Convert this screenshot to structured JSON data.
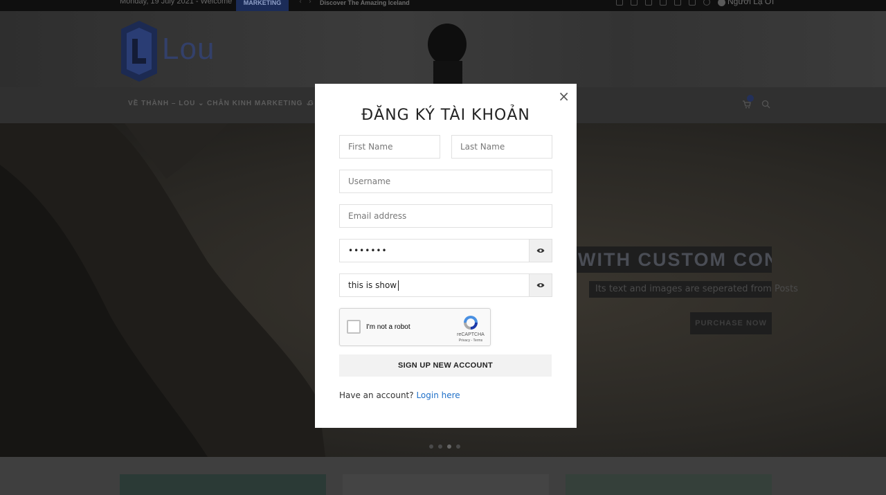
{
  "topbar": {
    "date": "Monday, 19 July 2021 - Welcome",
    "tag": "MARKETING",
    "news": "Discover The Amazing Iceland",
    "user": "Người Lạ Ơi"
  },
  "header": {
    "logo_text": "Lou"
  },
  "nav": {
    "items": [
      "VỀ THÀNH – LOU",
      "CHÂN KINH MARKETING",
      "G"
    ]
  },
  "hero": {
    "headline": "K WITH CUSTOM CONTENT",
    "subtext": "Its text and images are seperated from Posts",
    "button": "PURCHASE NOW"
  },
  "modal": {
    "title": "ĐĂNG KÝ TÀI KHOẢN",
    "close": "×",
    "first_name_placeholder": "First Name",
    "last_name_placeholder": "Last Name",
    "username_placeholder": "Username",
    "email_placeholder": "Email address",
    "password_value": "•••••••",
    "confirm_value": "this is show",
    "captcha": {
      "label": "I'm not a robot",
      "brand": "reCAPTCHA",
      "links": "Privacy - Terms"
    },
    "signup_button": "SIGN UP NEW ACCOUNT",
    "have_account": "Have an account?",
    "login_link": "Login here"
  },
  "colors": {
    "accent": "#1e6fc8",
    "overlay": "#2a2a2a"
  }
}
